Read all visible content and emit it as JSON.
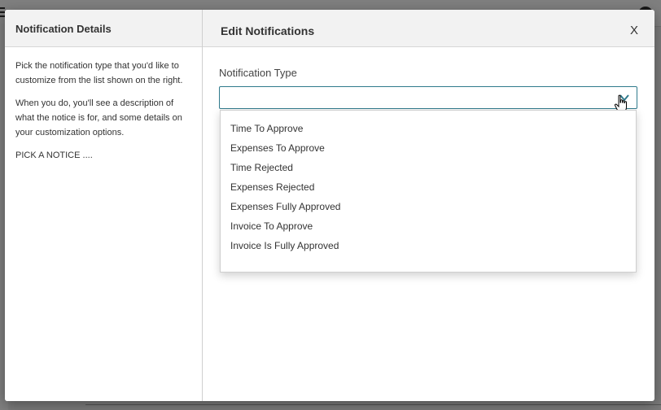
{
  "left_pane": {
    "title": "Notification Details",
    "paragraph1": "Pick the notification type that you'd like to customize from the list shown on the right.",
    "paragraph2": "When you do, you'll see a description of what the notice is for, and some details on your customization options.",
    "paragraph3": "PICK A NOTICE ...."
  },
  "right_pane": {
    "title": "Edit Notifications",
    "close_label": "X",
    "field_label": "Notification Type",
    "select_value": "",
    "options": [
      "Time To Approve",
      "Expenses To Approve",
      "Time Rejected",
      "Expenses Rejected",
      "Expenses Fully Approved",
      "Invoice To Approve",
      "Invoice Is Fully Approved"
    ]
  },
  "colors": {
    "accent": "#2f7a8c",
    "header_bg": "#f2f2f2"
  }
}
